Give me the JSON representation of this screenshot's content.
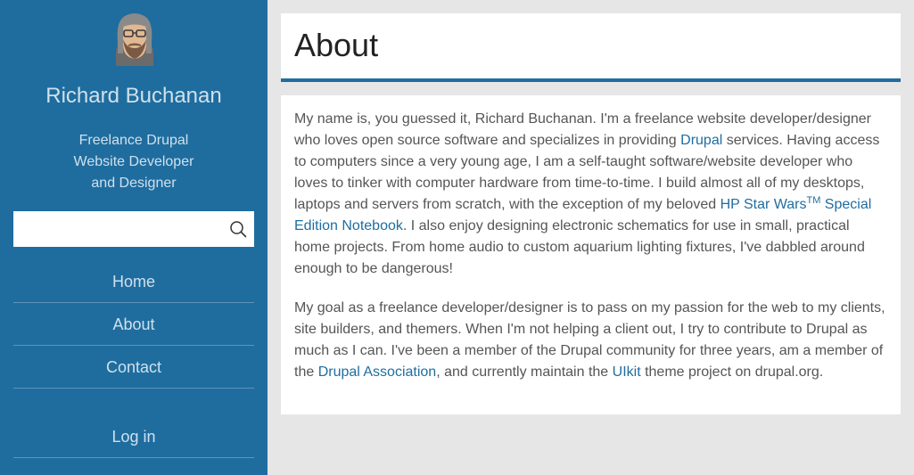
{
  "sidebar": {
    "site_name": "Richard Buchanan",
    "slogan": [
      "Freelance Drupal",
      "Website Developer",
      "and Designer"
    ],
    "search": {
      "value": "",
      "placeholder": ""
    },
    "nav": [
      "Home",
      "About",
      "Contact"
    ],
    "account": [
      "Log in"
    ]
  },
  "page": {
    "title": "About",
    "p1": {
      "t1": "My name is, you guessed it, Richard Buchanan. I'm a freelance website developer/designer who loves open source software and specializes in providing ",
      "link1": "Drupal",
      "t2": " services. Having access to computers since a very young age, I am a self-taught software/website developer who loves to tinker with computer hardware from time-to-time. I build almost all of my desktops, laptops and servers from scratch, with the exception of my beloved ",
      "link2a": "HP Star Wars",
      "link2tm": "TM",
      "link2b": " Special Edition Notebook",
      "t3": ". I also enjoy designing electronic schematics for use in small, practical home projects. From home audio to custom aquarium lighting fixtures, I've dabbled around enough to be dangerous!"
    },
    "p2": {
      "t1": "My goal as a freelance developer/designer is to pass on my passion for the web to my clients, site builders, and themers. When I'm not helping a client out, I try to contribute to Drupal as much as I can. I've been a member of the Drupal community for three years, am a member of the ",
      "link1": "Drupal Association",
      "t2": ", and currently maintain the ",
      "link2": "UIkit",
      "t3": " theme project on drupal.org."
    }
  },
  "colors": {
    "sidebar_bg": "#1f6d9f",
    "link": "#1f6d9f",
    "page_bg": "#e6e6e6"
  },
  "icons": [
    "avatar",
    "search-icon"
  ]
}
